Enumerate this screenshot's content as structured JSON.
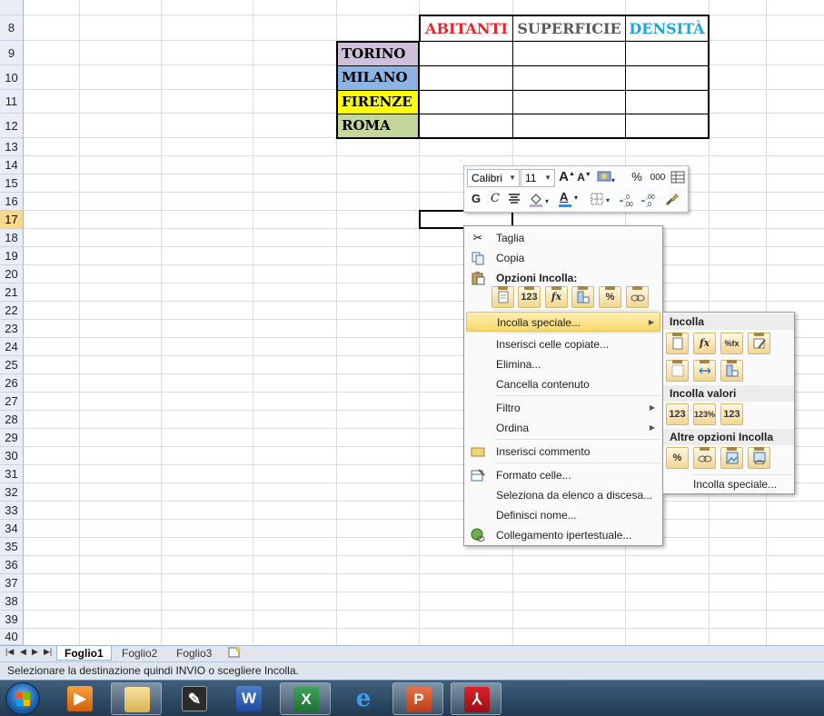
{
  "sheet": {
    "rows": [
      "8",
      "9",
      "10",
      "11",
      "12",
      "13",
      "14",
      "15",
      "16",
      "17",
      "18",
      "19",
      "20",
      "21",
      "22",
      "23",
      "24",
      "25",
      "26",
      "27",
      "28",
      "29",
      "30",
      "31",
      "32",
      "33",
      "34",
      "35",
      "36",
      "37",
      "38",
      "39",
      "40"
    ],
    "selected_row": "17",
    "table": {
      "headers": [
        {
          "text": "ABITANTI",
          "color": "#e8262a"
        },
        {
          "text": "SUPERFICIE",
          "color": "#5b5b5b"
        },
        {
          "text": "DENSITÀ",
          "color": "#1aa6d9"
        }
      ],
      "cities": [
        {
          "name": "TORINO",
          "bg": "#ccc0da"
        },
        {
          "name": "MILANO",
          "bg": "#8db4e2"
        },
        {
          "name": "FIRENZE",
          "bg": "#ffff00"
        },
        {
          "name": "ROMA",
          "bg": "#c4d79b"
        }
      ]
    }
  },
  "mini_toolbar": {
    "font": "Calibri",
    "size": "11",
    "grow_font": "A",
    "shrink_font": "A",
    "percent": "%",
    "thousands": "000",
    "bold": "G",
    "italic": "C",
    "font_color": "A"
  },
  "context_menu": {
    "items": {
      "cut": "Taglia",
      "copy": "Copia",
      "paste_options_header": "Opzioni Incolla:",
      "paste_special": "Incolla speciale...",
      "insert_copied": "Inserisci celle copiate...",
      "delete": "Elimina...",
      "clear": "Cancella contenuto",
      "filter": "Filtro",
      "sort": "Ordina",
      "insert_comment": "Inserisci commento",
      "format_cells": "Formato celle...",
      "pick_list": "Seleziona da elenco a discesa...",
      "define_name": "Definisci nome...",
      "hyperlink": "Collegamento ipertestuale..."
    },
    "paste_buttons": [
      "",
      "123",
      "fx",
      "",
      "%",
      ""
    ]
  },
  "submenu": {
    "group_paste": "Incolla",
    "group_values": "Incolla valori",
    "group_other": "Altre opzioni Incolla",
    "footer": "Incolla speciale...",
    "paste_icons_row1": [
      "",
      "fx",
      "%fx",
      ""
    ],
    "paste_icons_row2": [
      "",
      "",
      ""
    ],
    "values_icons": [
      "123",
      "123%",
      "123"
    ],
    "other_icons": [
      "%",
      "",
      "",
      ""
    ]
  },
  "tabs": [
    "Foglio1",
    "Foglio2",
    "Foglio3"
  ],
  "active_tab": "Foglio1",
  "status_text": "Selezionare la destinazione quindi INVIO o scegliere Incolla.",
  "taskbar": {
    "apps": [
      "media-player",
      "explorer",
      "sticky-tool",
      "word",
      "excel",
      "internet-explorer",
      "powerpoint",
      "acrobat"
    ],
    "open_app": "excel"
  }
}
